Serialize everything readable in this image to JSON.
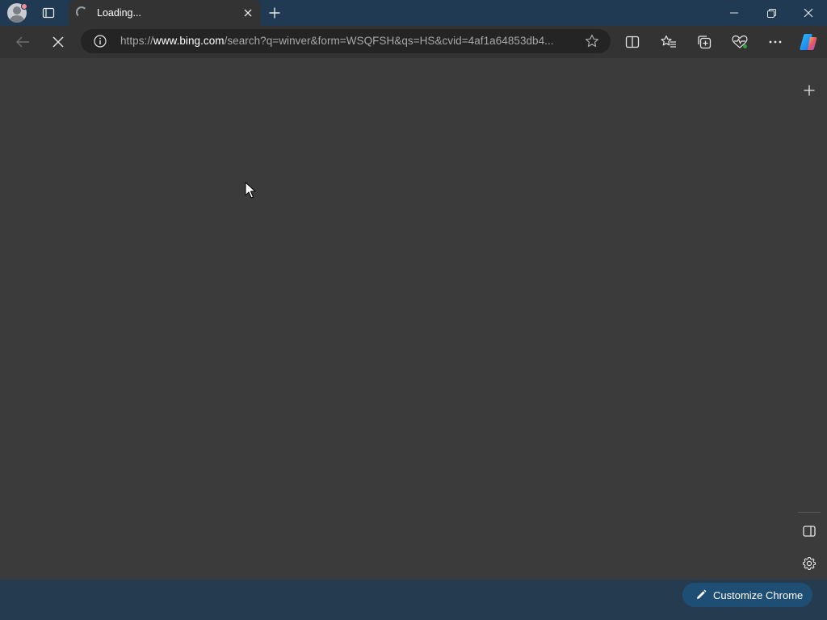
{
  "tab": {
    "title": "Loading..."
  },
  "omnibox": {
    "url_scheme": "https://",
    "url_host": "www.bing.com",
    "url_rest": "/search?q=winver&form=WSQFSH&qs=HS&cvid=4af1a64853db4..."
  },
  "bottom": {
    "customize_label": "Customize Chrome"
  },
  "icons": {
    "profile": "avatar-icon",
    "tab_actions": "tab-actions-icon",
    "tab_spinner": "loading-spinner-icon",
    "tab_close": "close-icon",
    "new_tab": "plus-icon",
    "minimize": "minimize-icon",
    "restore": "restore-icon",
    "close_window": "close-icon",
    "back": "back-arrow-icon",
    "stop": "stop-icon",
    "site_info": "info-icon",
    "favorite": "star-icon",
    "split_screen": "split-screen-icon",
    "favorites": "favorites-icon",
    "collections": "collections-icon",
    "performance": "heartbeat-icon",
    "more": "more-icon",
    "copilot": "copilot-icon",
    "sidebar_add": "plus-icon",
    "sidebar_toggle": "sidebar-icon",
    "settings": "gear-icon",
    "edit": "pencil-icon"
  },
  "colors": {
    "frame": "#1f3a52",
    "toolbar": "#333333",
    "content": "#3b3b3b",
    "omnibox": "#242424",
    "accent_button": "#1f4e74"
  }
}
